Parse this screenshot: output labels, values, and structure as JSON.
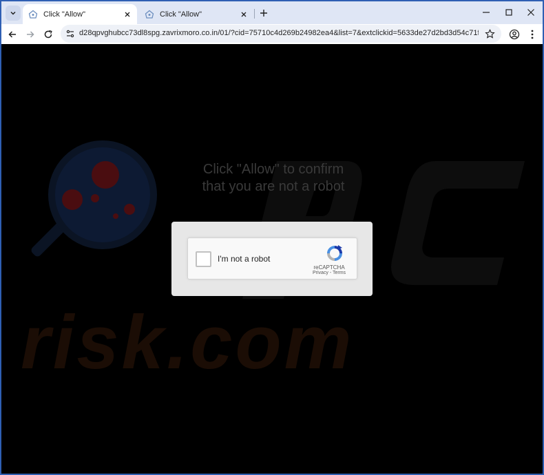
{
  "browser": {
    "tabs": [
      {
        "title": "Click \"Allow\"",
        "active": true
      },
      {
        "title": "Click \"Allow\"",
        "active": false
      }
    ],
    "url": "d28qpvghubcc73dl8spg.zavrixmoro.co.in/01/?cid=75710c4d269b24982ea4&list=7&extclickid=5633de27d2bd3d54c71f7920bdf70..."
  },
  "page": {
    "message_line1": "Click \"Allow\" to confirm",
    "message_line2": "that you are not a robot",
    "watermark": "risk.com",
    "captcha": {
      "label": "I'm not a robot",
      "brand": "reCAPTCHA",
      "privacy": "Privacy",
      "separator": " - ",
      "terms": "Terms"
    }
  },
  "colors": {
    "window_border": "#2f5fb3",
    "tabstrip": "#dfe6f5",
    "captcha_blue": "#1c3aa9"
  }
}
